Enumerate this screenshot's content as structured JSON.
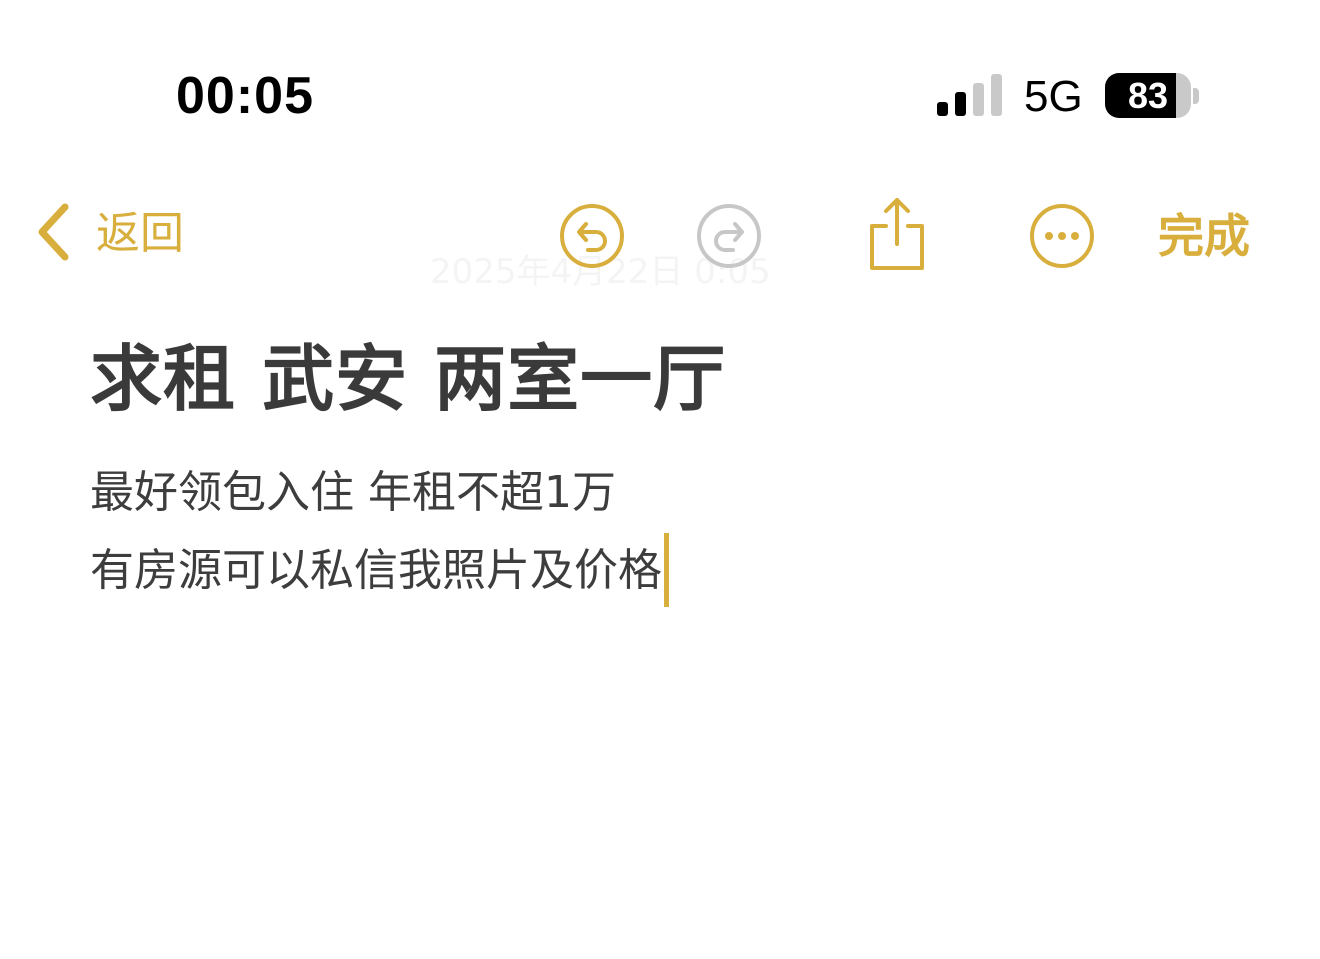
{
  "status_bar": {
    "time": "00:05",
    "network": "5G",
    "battery_level": "83",
    "battery_fraction": 0.83,
    "signal_bars_active": 2,
    "signal_bars_total": 4
  },
  "toolbar": {
    "back_label": "返回",
    "done_label": "完成",
    "icons": {
      "back": "chevron-left-icon",
      "undo": "undo-icon",
      "redo": "redo-icon",
      "share": "share-icon",
      "more": "more-options-icon"
    },
    "redo_enabled": false
  },
  "note": {
    "date_faded": "2025年4月22日 0:05",
    "title": "求租 武安 两室一厅",
    "lines": [
      "最好领包入住 年租不超1万",
      "有房源可以私信我照片及价格"
    ]
  },
  "colors": {
    "accent": "#d8ae3c",
    "disabled": "#c7c7c7",
    "text": "#3d3d3d"
  }
}
